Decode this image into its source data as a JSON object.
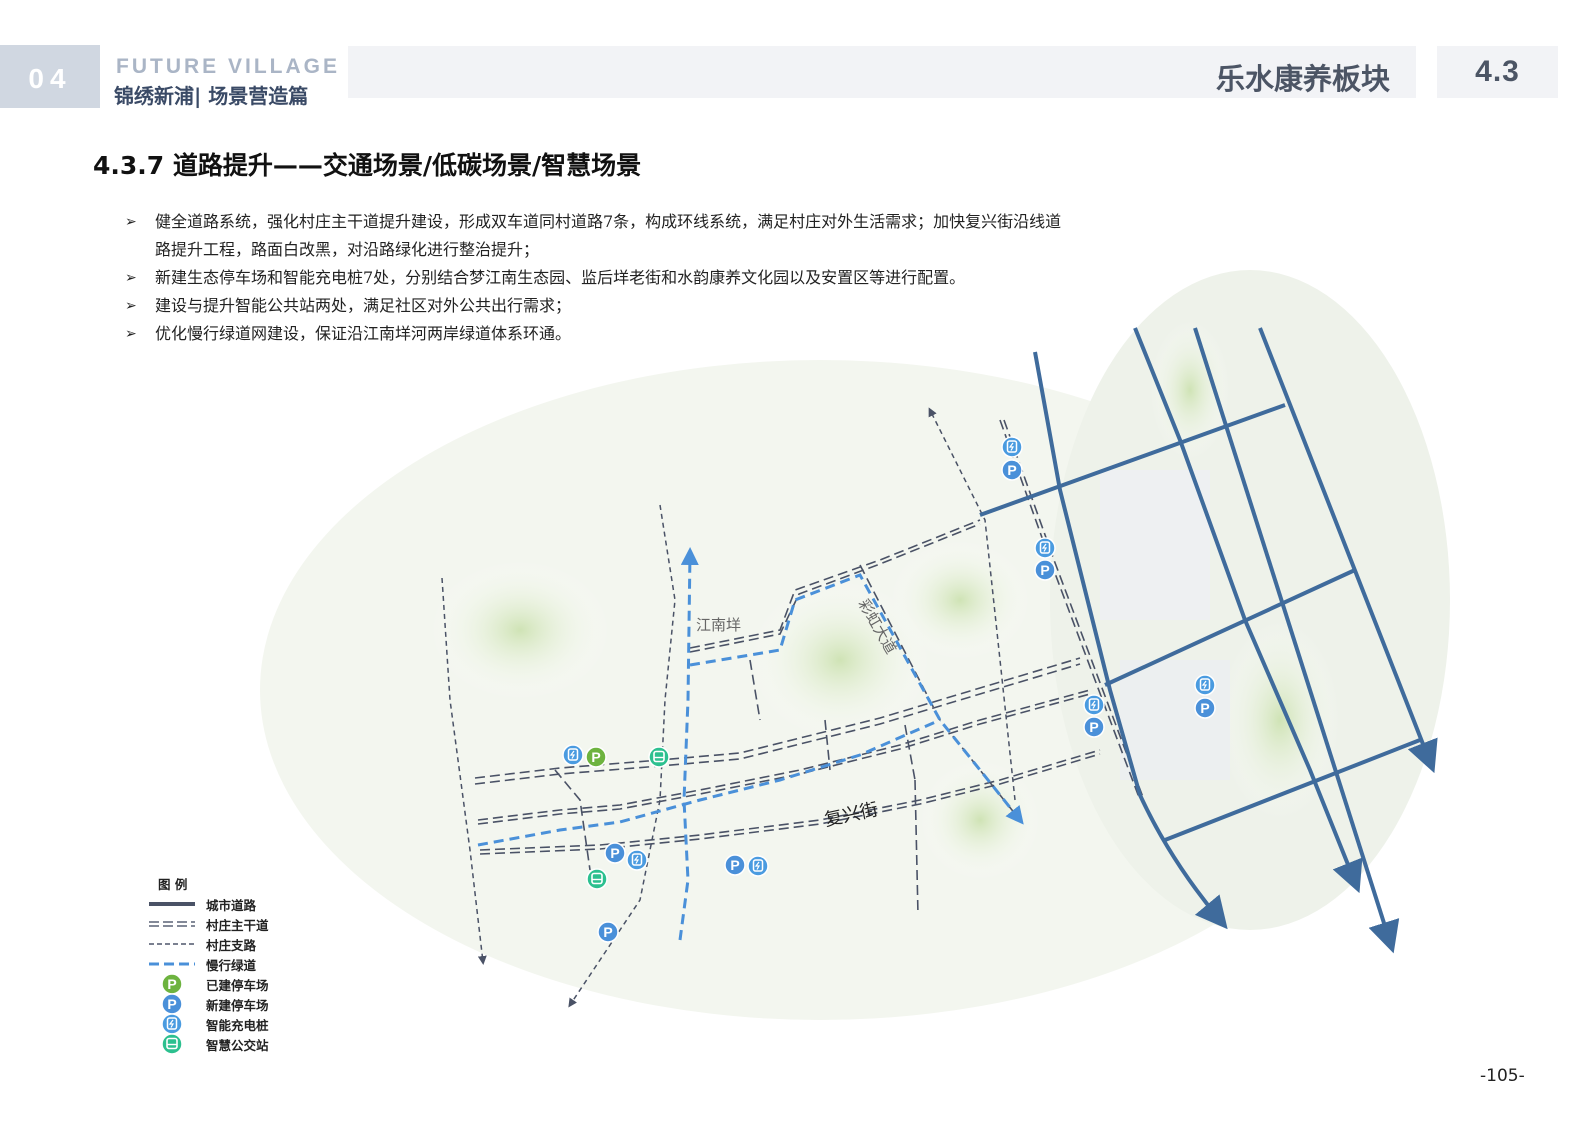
{
  "header": {
    "section_number": "04",
    "brand_en": "FUTURE VILLAGE",
    "brand_cn": "锦绣新浦| 场景营造篇",
    "block_title": "乐水康养板块",
    "section_code": "4.3"
  },
  "title": "4.3.7 道路提升——交通场景/低碳场景/智慧场景",
  "bullets": [
    "健全道路系统，强化村庄主干道提升建设，形成双车道同村道路7条，构成环线系统，满足村庄对外生活需求；加快复兴街沿线道路提升工程，路面白改黑，对沿路绿化进行整治提升；",
    "新建生态停车场和智能充电桩7处，分别结合梦江南生态园、监后垟老街和水韵康养文化园以及安置区等进行配置。",
    "建设与提升智能公共站两处，满足社区对外公共出行需求；",
    "优化慢行绿道网建设，保证沿江南垟河两岸绿道体系环通。"
  ],
  "bullet_marker": "➢",
  "map": {
    "labels": {
      "river": "江南垟",
      "avenue": "彩虹大道",
      "street": "复兴街"
    },
    "colors": {
      "city_road": "#3f6b9c",
      "village_road": "#4a5266",
      "slow_lane": "#4a90d9",
      "parking_existing": "#6db33f",
      "parking_new": "#4a90d9",
      "charging": "#4a9be0",
      "bus": "#2cc08f"
    }
  },
  "legend": {
    "title": "图 例",
    "items": [
      {
        "label": "城市道路",
        "icon": "solid-line"
      },
      {
        "label": "村庄主干道",
        "icon": "double-dashed-line"
      },
      {
        "label": "村庄支路",
        "icon": "dashed-line"
      },
      {
        "label": "慢行绿道",
        "icon": "blue-dashed-line"
      },
      {
        "label": "已建停车场",
        "icon": "parking-icon-green"
      },
      {
        "label": "新建停车场",
        "icon": "parking-icon-blue"
      },
      {
        "label": "智能充电桩",
        "icon": "charging-icon"
      },
      {
        "label": "智慧公交站",
        "icon": "bus-icon"
      }
    ]
  },
  "page_number": "-105-"
}
